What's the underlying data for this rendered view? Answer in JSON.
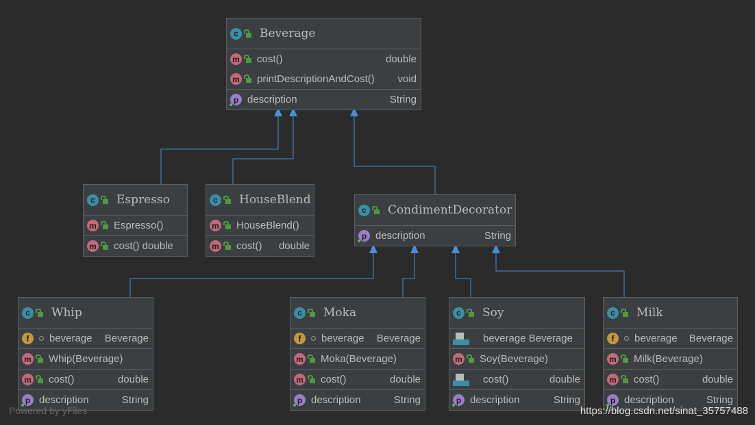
{
  "diagram": {
    "link_color": "#4a8fd8",
    "classes": [
      {
        "id": "beverage",
        "name": "Beverage",
        "icon": "abstract-class-icon",
        "sections": [
          [
            {
              "icon": "m",
              "lock": true,
              "name": "cost()",
              "type": "double"
            },
            {
              "icon": "m",
              "lock": true,
              "name": "printDescriptionAndCost()",
              "type": "void"
            }
          ],
          [
            {
              "icon": "p",
              "name": "description",
              "type": "String"
            }
          ]
        ]
      },
      {
        "id": "espresso",
        "name": "Espresso",
        "icon": "class-icon",
        "sections": [
          [
            {
              "icon": "m",
              "lock": true,
              "name": "Espresso()",
              "type": ""
            }
          ],
          [
            {
              "icon": "m",
              "lock": true,
              "name": "cost() double",
              "type": ""
            }
          ]
        ]
      },
      {
        "id": "houseblend",
        "name": "HouseBlend",
        "icon": "class-icon",
        "sections": [
          [
            {
              "icon": "m",
              "lock": true,
              "name": "HouseBlend()",
              "type": ""
            }
          ],
          [
            {
              "icon": "m",
              "lock": true,
              "name": "cost()",
              "type": "double"
            }
          ]
        ]
      },
      {
        "id": "condiment",
        "name": "CondimentDecorator",
        "icon": "abstract-class-icon",
        "sections": [
          [
            {
              "icon": "p",
              "name": "description",
              "type": "String"
            }
          ]
        ]
      },
      {
        "id": "whip",
        "name": "Whip",
        "icon": "class-icon",
        "sections": [
          [
            {
              "icon": "f",
              "dot": true,
              "name": "beverage",
              "type": "Beverage"
            }
          ],
          [
            {
              "icon": "m",
              "lock": true,
              "name": "Whip(Beverage)",
              "type": ""
            }
          ],
          [
            {
              "icon": "m",
              "lock": true,
              "name": "cost()",
              "type": "double"
            }
          ],
          [
            {
              "icon": "p",
              "name": "description",
              "type": "String"
            }
          ]
        ]
      },
      {
        "id": "moka",
        "name": "Moka",
        "icon": "class-icon",
        "sections": [
          [
            {
              "icon": "f",
              "dot": true,
              "name": "beverage",
              "type": "Beverage"
            }
          ],
          [
            {
              "icon": "m",
              "lock": true,
              "name": "Moka(Beverage)",
              "type": ""
            }
          ],
          [
            {
              "icon": "m",
              "lock": true,
              "name": "cost()",
              "type": "double"
            }
          ],
          [
            {
              "icon": "p",
              "name": "description",
              "type": "String"
            }
          ]
        ]
      },
      {
        "id": "soy",
        "name": "Soy",
        "icon": "class-icon",
        "sections": [
          [
            {
              "icon": "j",
              "name": "beverage Beverage",
              "type": ""
            }
          ],
          [
            {
              "icon": "m",
              "lock": true,
              "name": "Soy(Beverage)",
              "type": ""
            }
          ],
          [
            {
              "icon": "j",
              "name": "cost()",
              "type": "double"
            }
          ],
          [
            {
              "icon": "p",
              "name": "description",
              "type": "String"
            }
          ]
        ]
      },
      {
        "id": "milk",
        "name": "Milk",
        "icon": "class-icon",
        "sections": [
          [
            {
              "icon": "f",
              "dot": true,
              "name": "beverage",
              "type": "Beverage"
            }
          ],
          [
            {
              "icon": "m",
              "lock": true,
              "name": "Milk(Beverage)",
              "type": ""
            }
          ],
          [
            {
              "icon": "m",
              "lock": true,
              "name": "cost()",
              "type": "double"
            }
          ],
          [
            {
              "icon": "p",
              "name": "description",
              "type": "String"
            }
          ]
        ]
      }
    ],
    "inheritance": [
      {
        "from": "espresso",
        "to": "beverage"
      },
      {
        "from": "houseblend",
        "to": "beverage"
      },
      {
        "from": "condiment",
        "to": "beverage"
      },
      {
        "from": "whip",
        "to": "condiment"
      },
      {
        "from": "moka",
        "to": "condiment"
      },
      {
        "from": "soy",
        "to": "condiment"
      },
      {
        "from": "milk",
        "to": "condiment"
      }
    ]
  },
  "watermark": {
    "left": "Powered by yFiles",
    "right": "https://blog.csdn.net/sinat_35757488"
  }
}
